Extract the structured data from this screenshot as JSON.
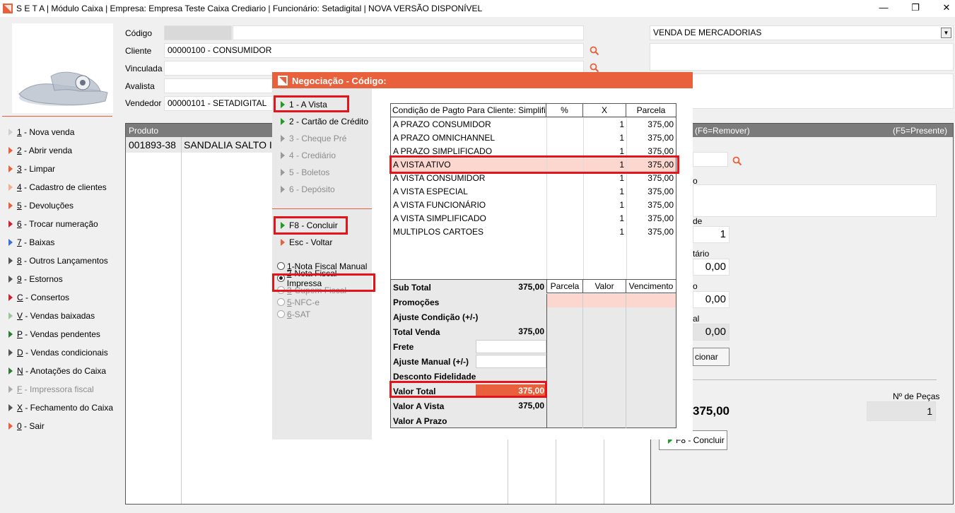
{
  "window": {
    "title": "S E T A | Módulo Caixa | Empresa: Empresa Teste Caixa Crediario | Funcionário: Setadigital  |  NOVA  VERSÃO  DISPONÍVEL",
    "minimize": "—",
    "restore": "❐",
    "close": "✕"
  },
  "form": {
    "codigo_label": "Código",
    "cliente_label": "Cliente",
    "cliente_value": "00000100 - CONSUMIDOR",
    "vinculada_label": "Vinculada",
    "avalista_label": "Avalista",
    "vendedor_label": "Vendedor",
    "vendedor_value": "00000101 - SETADIGITAL",
    "operation_select": "VENDA DE MERCADORIAS"
  },
  "menu": [
    {
      "key": "1",
      "label": " - Nova venda",
      "color": "#cfcfcf"
    },
    {
      "key": "2",
      "label": " - Abrir venda",
      "color": "#e8603c"
    },
    {
      "key": "3",
      "label": " - Limpar",
      "color": "#e8603c"
    },
    {
      "key": "4",
      "label": " - Cadastro de clientes",
      "color": "#f0b090"
    },
    {
      "key": "5",
      "label": " - Devoluções",
      "color": "#e8603c"
    },
    {
      "key": "6",
      "label": " - Trocar numeração",
      "color": "#d01f2f"
    },
    {
      "key": "7",
      "label": " - Baixas",
      "color": "#3a6fd8"
    },
    {
      "key": "8",
      "label": " - Outros Lançamentos",
      "color": "#555"
    },
    {
      "key": "9",
      "label": " - Estornos",
      "color": "#555"
    },
    {
      "key": "C",
      "label": " - Consertos",
      "color": "#d01f2f"
    },
    {
      "key": "V",
      "label": " - Vendas baixadas",
      "color": "#9ac49a"
    },
    {
      "key": "P",
      "label": " - Vendas pendentes",
      "color": "#2e7d32"
    },
    {
      "key": "D",
      "label": " - Vendas condicionais",
      "color": "#555"
    },
    {
      "key": "N",
      "label": " - Anotações do Caixa",
      "color": "#2e7d32"
    },
    {
      "key": "F",
      "label": " - Impressora fiscal",
      "color": "#aaa",
      "disabled": true
    },
    {
      "key": "X",
      "label": " - Fechamento do Caixa",
      "color": "#555"
    },
    {
      "key": "0",
      "label": " - Sair",
      "color": "#e8603c"
    }
  ],
  "grid": {
    "header_produto": "Produto",
    "row_code": "001893-38",
    "row_desc": "SANDALIA SALTO I"
  },
  "right_panel": {
    "header_left": "ntos (F6=Remover)",
    "header_right": "(F5=Presente)",
    "label_o": "o",
    "label_de": "de",
    "qtd_value": "1",
    "label_tario": "tário",
    "unit_value": "0,00",
    "label_o2": "o",
    "disc_value": "0,00",
    "label_al": "al",
    "total_value": "0,00",
    "btn_adicionar": "cionar",
    "total_big": "375,00",
    "pecas_label": "Nº de Peças",
    "pecas_value": "1",
    "btn_concluir": "F8 - Concluir"
  },
  "dialog": {
    "title": "Negociação - Código:",
    "options": [
      {
        "label": "1 - A Vista",
        "state": "active"
      },
      {
        "label": "2 - Cartão de Crédito",
        "state": "active"
      },
      {
        "label": "3 - Cheque Pré",
        "state": "disabled"
      },
      {
        "label": "4 - Crediário",
        "state": "disabled"
      },
      {
        "label": "5 - Boletos",
        "state": "disabled"
      },
      {
        "label": "6 - Depósito",
        "state": "disabled"
      }
    ],
    "concluir": "F8 - Concluir",
    "voltar": "Esc - Voltar",
    "nf_options": [
      {
        "key": "1",
        "label": "-Nota Fiscal Manual",
        "checked": false,
        "disabled": false
      },
      {
        "key": "2",
        "label": "-Nota Fiscal Impressa",
        "checked": true,
        "disabled": false
      },
      {
        "key": "3",
        "label": "-Cupom Fiscal",
        "checked": false,
        "disabled": true
      },
      {
        "key": "5",
        "label": "-NFC-e",
        "checked": false,
        "disabled": true
      },
      {
        "key": "6",
        "label": "-SAT",
        "checked": false,
        "disabled": true
      }
    ],
    "table_headers": [
      "Condição de Pagto Para Cliente: Simplific",
      "%",
      "X",
      "Parcela"
    ],
    "conditions": [
      {
        "name": "A PRAZO CONSUMIDOR",
        "pct": "",
        "x": "1",
        "parcela": "375,00"
      },
      {
        "name": "A PRAZO OMNICHANNEL",
        "pct": "",
        "x": "1",
        "parcela": "375,00"
      },
      {
        "name": "A PRAZO SIMPLIFICADO",
        "pct": "",
        "x": "1",
        "parcela": "375,00"
      },
      {
        "name": "A VISTA ATIVO",
        "pct": "",
        "x": "1",
        "parcela": "375,00",
        "selected": true
      },
      {
        "name": "A VISTA CONSUMIDOR",
        "pct": "",
        "x": "1",
        "parcela": "375,00"
      },
      {
        "name": "A VISTA ESPECIAL",
        "pct": "",
        "x": "1",
        "parcela": "375,00"
      },
      {
        "name": "A VISTA FUNCIONÁRIO",
        "pct": "",
        "x": "1",
        "parcela": "375,00"
      },
      {
        "name": "A VISTA SIMPLIFICADO",
        "pct": "",
        "x": "1",
        "parcela": "375,00"
      },
      {
        "name": "MULTIPLOS CARTOES",
        "pct": "",
        "x": "1",
        "parcela": "375,00"
      }
    ],
    "parcel_headers": [
      "Parcela",
      "Valor",
      "Vencimento"
    ],
    "summary": [
      {
        "label": "Sub Total",
        "value": "375,00"
      },
      {
        "label": "Promoções",
        "value": ""
      },
      {
        "label": "Ajuste Condição (+/-)",
        "value": ""
      },
      {
        "label": "Total Venda",
        "value": "375,00"
      },
      {
        "label": "Frete",
        "value": ""
      },
      {
        "label": "Ajuste Manual (+/-)",
        "value": ""
      },
      {
        "label": "Desconto Fidelidade",
        "value": ""
      },
      {
        "label": "Valor Total",
        "value": "375,00"
      },
      {
        "label": "Valor A Vista",
        "value": "375,00"
      },
      {
        "label": "Valor A Prazo",
        "value": ""
      }
    ]
  },
  "colors": {
    "accent": "#e8603c",
    "highlight_red": "#e5141b",
    "selected_row": "#fbd7cf"
  }
}
